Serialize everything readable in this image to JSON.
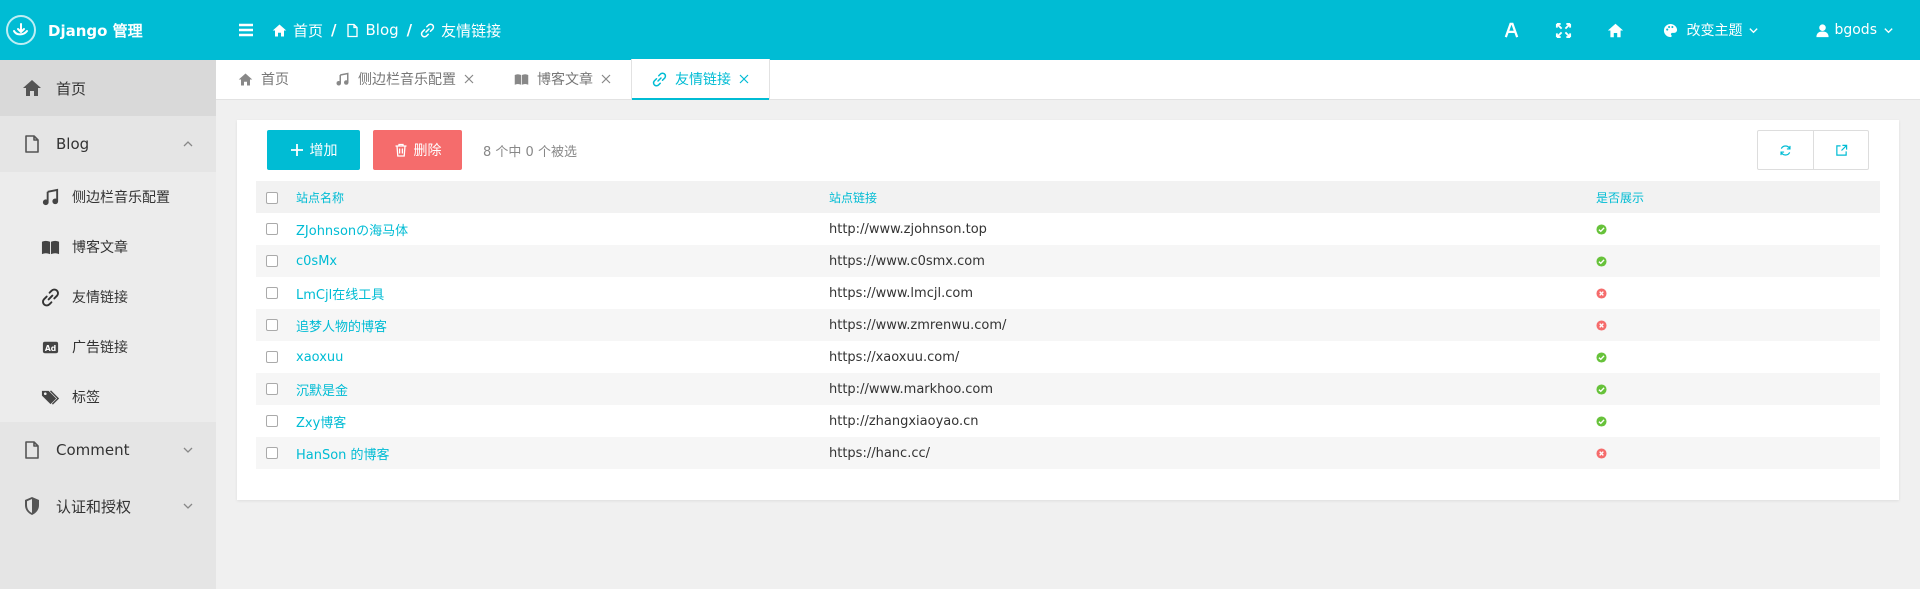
{
  "brand": {
    "title": "Django 管理"
  },
  "sidebar": {
    "home": {
      "label": "首页",
      "icon": "home-icon"
    },
    "blog": {
      "label": "Blog",
      "icon": "file-icon"
    },
    "blog_items": [
      {
        "label": "侧边栏音乐配置",
        "icon": "music-icon"
      },
      {
        "label": "博客文章",
        "icon": "book-icon"
      },
      {
        "label": "友情链接",
        "icon": "link-icon"
      },
      {
        "label": "广告链接",
        "icon": "ad-icon"
      },
      {
        "label": "标签",
        "icon": "tags-icon"
      }
    ],
    "comment": {
      "label": "Comment",
      "icon": "file-icon"
    },
    "auth": {
      "label": "认证和授权",
      "icon": "shield-icon"
    }
  },
  "header": {
    "breadcrumb": [
      "首页",
      "Blog",
      "友情链接"
    ],
    "separator": "/",
    "theme_label": "改变主题",
    "user_label": "bgods"
  },
  "tabs": [
    {
      "label": "首页",
      "closable": false
    },
    {
      "label": "侧边栏音乐配置",
      "closable": true
    },
    {
      "label": "博客文章",
      "closable": true
    },
    {
      "label": "友情链接",
      "closable": true,
      "active": true
    }
  ],
  "toolbar": {
    "add_label": "增加",
    "delete_label": "删除",
    "selection_info": "8 个中 0 个被选"
  },
  "table": {
    "columns": [
      "站点名称",
      "站点链接",
      "是否展示"
    ],
    "rows": [
      {
        "name": "ZJohnsonの海马体",
        "url": "http://www.zjohnson.top",
        "shown": true
      },
      {
        "name": "c0sMx",
        "url": "https://www.c0smx.com",
        "shown": true
      },
      {
        "name": "LmCjl在线工具",
        "url": "https://www.lmcjl.com",
        "shown": false
      },
      {
        "name": "追梦人物的博客",
        "url": "https://www.zmrenwu.com/",
        "shown": false
      },
      {
        "name": "xaoxuu",
        "url": "https://xaoxuu.com/",
        "shown": true
      },
      {
        "name": "沉默是金",
        "url": "http://www.markhoo.com",
        "shown": true
      },
      {
        "name": "Zxy博客",
        "url": "http://zhangxiaoyao.cn",
        "shown": true
      },
      {
        "name": "HanSon 的博客",
        "url": "https://hanc.cc/",
        "shown": false
      }
    ]
  },
  "colors": {
    "accent": "#00bcd4",
    "danger": "#f56c6c",
    "yes": "#67c23a",
    "no": "#f56c6c"
  }
}
